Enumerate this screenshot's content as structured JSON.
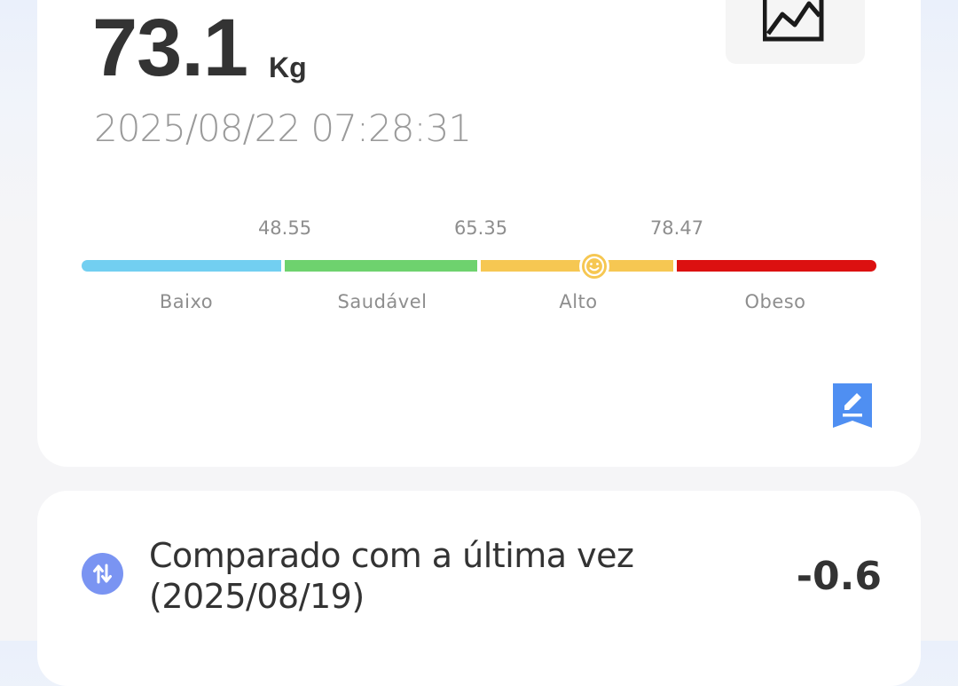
{
  "measurement": {
    "weight": "73.1",
    "unit": "Kg",
    "datetime": "2025/08/22 07:28:31"
  },
  "scale": {
    "thresholds": [
      "48.55",
      "65.35",
      "78.47"
    ],
    "categories": [
      "Baixo",
      "Saudável",
      "Alto",
      "Obeso"
    ],
    "active_category": "Alto",
    "colors": {
      "low": "#72cff1",
      "healthy": "#6ed26e",
      "high": "#f6c752",
      "obese": "#dc1010"
    },
    "marker_icon": "smiley-face-icon"
  },
  "icons": {
    "trend": "trend-chart-icon",
    "edit": "edit-pencil-icon",
    "compare": "compare-arrows-icon"
  },
  "comparison": {
    "label": "Comparado com a última vez",
    "date": "(2025/08/19)",
    "value": "-0.6"
  }
}
